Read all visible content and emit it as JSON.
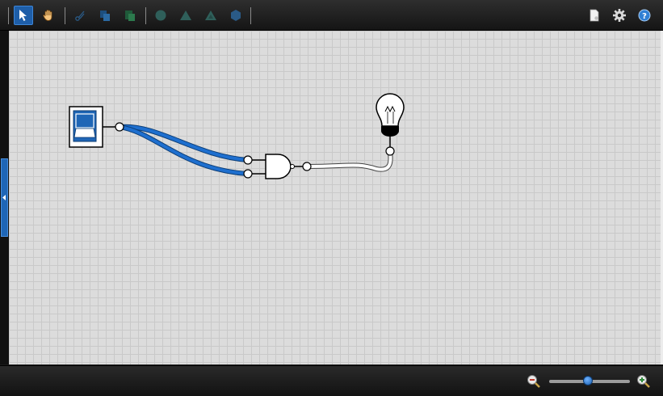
{
  "toolbar": {
    "tools": [
      {
        "name": "select-tool",
        "icon": "arrow-pointer-icon",
        "active": true
      },
      {
        "name": "pan-tool",
        "icon": "hand-icon",
        "active": false
      },
      {
        "name": "cut-tool",
        "icon": "scissors-icon",
        "active": false
      },
      {
        "name": "copy-tool",
        "icon": "copy-icon",
        "active": false
      },
      {
        "name": "paste-tool",
        "icon": "paste-icon",
        "active": false
      },
      {
        "name": "shape-tool-1",
        "icon": "circle-shape-icon",
        "active": false
      },
      {
        "name": "shape-tool-2",
        "icon": "triangle-shape-icon",
        "active": false
      },
      {
        "name": "shape-tool-3",
        "icon": "triangle-steps-icon",
        "active": false
      },
      {
        "name": "shape-tool-4",
        "icon": "hexagon-shape-icon",
        "active": false
      },
      {
        "name": "document-tool",
        "icon": "document-icon",
        "active": false
      },
      {
        "name": "settings-tool",
        "icon": "gear-icon",
        "active": false
      },
      {
        "name": "help-tool",
        "icon": "help-icon",
        "active": false
      }
    ]
  },
  "circuit": {
    "components": [
      "switch",
      "and-gate",
      "light-bulb"
    ],
    "wire_color_active": "#1e6fcf",
    "wire_color_inactive": "#ffffff"
  },
  "zoom": {
    "level": 0.48,
    "zoom_out_icon": "zoom-out-icon",
    "zoom_in_icon": "zoom-in-icon"
  },
  "colors": {
    "accent": "#1f66b6",
    "canvas": "#dcdcdc"
  }
}
